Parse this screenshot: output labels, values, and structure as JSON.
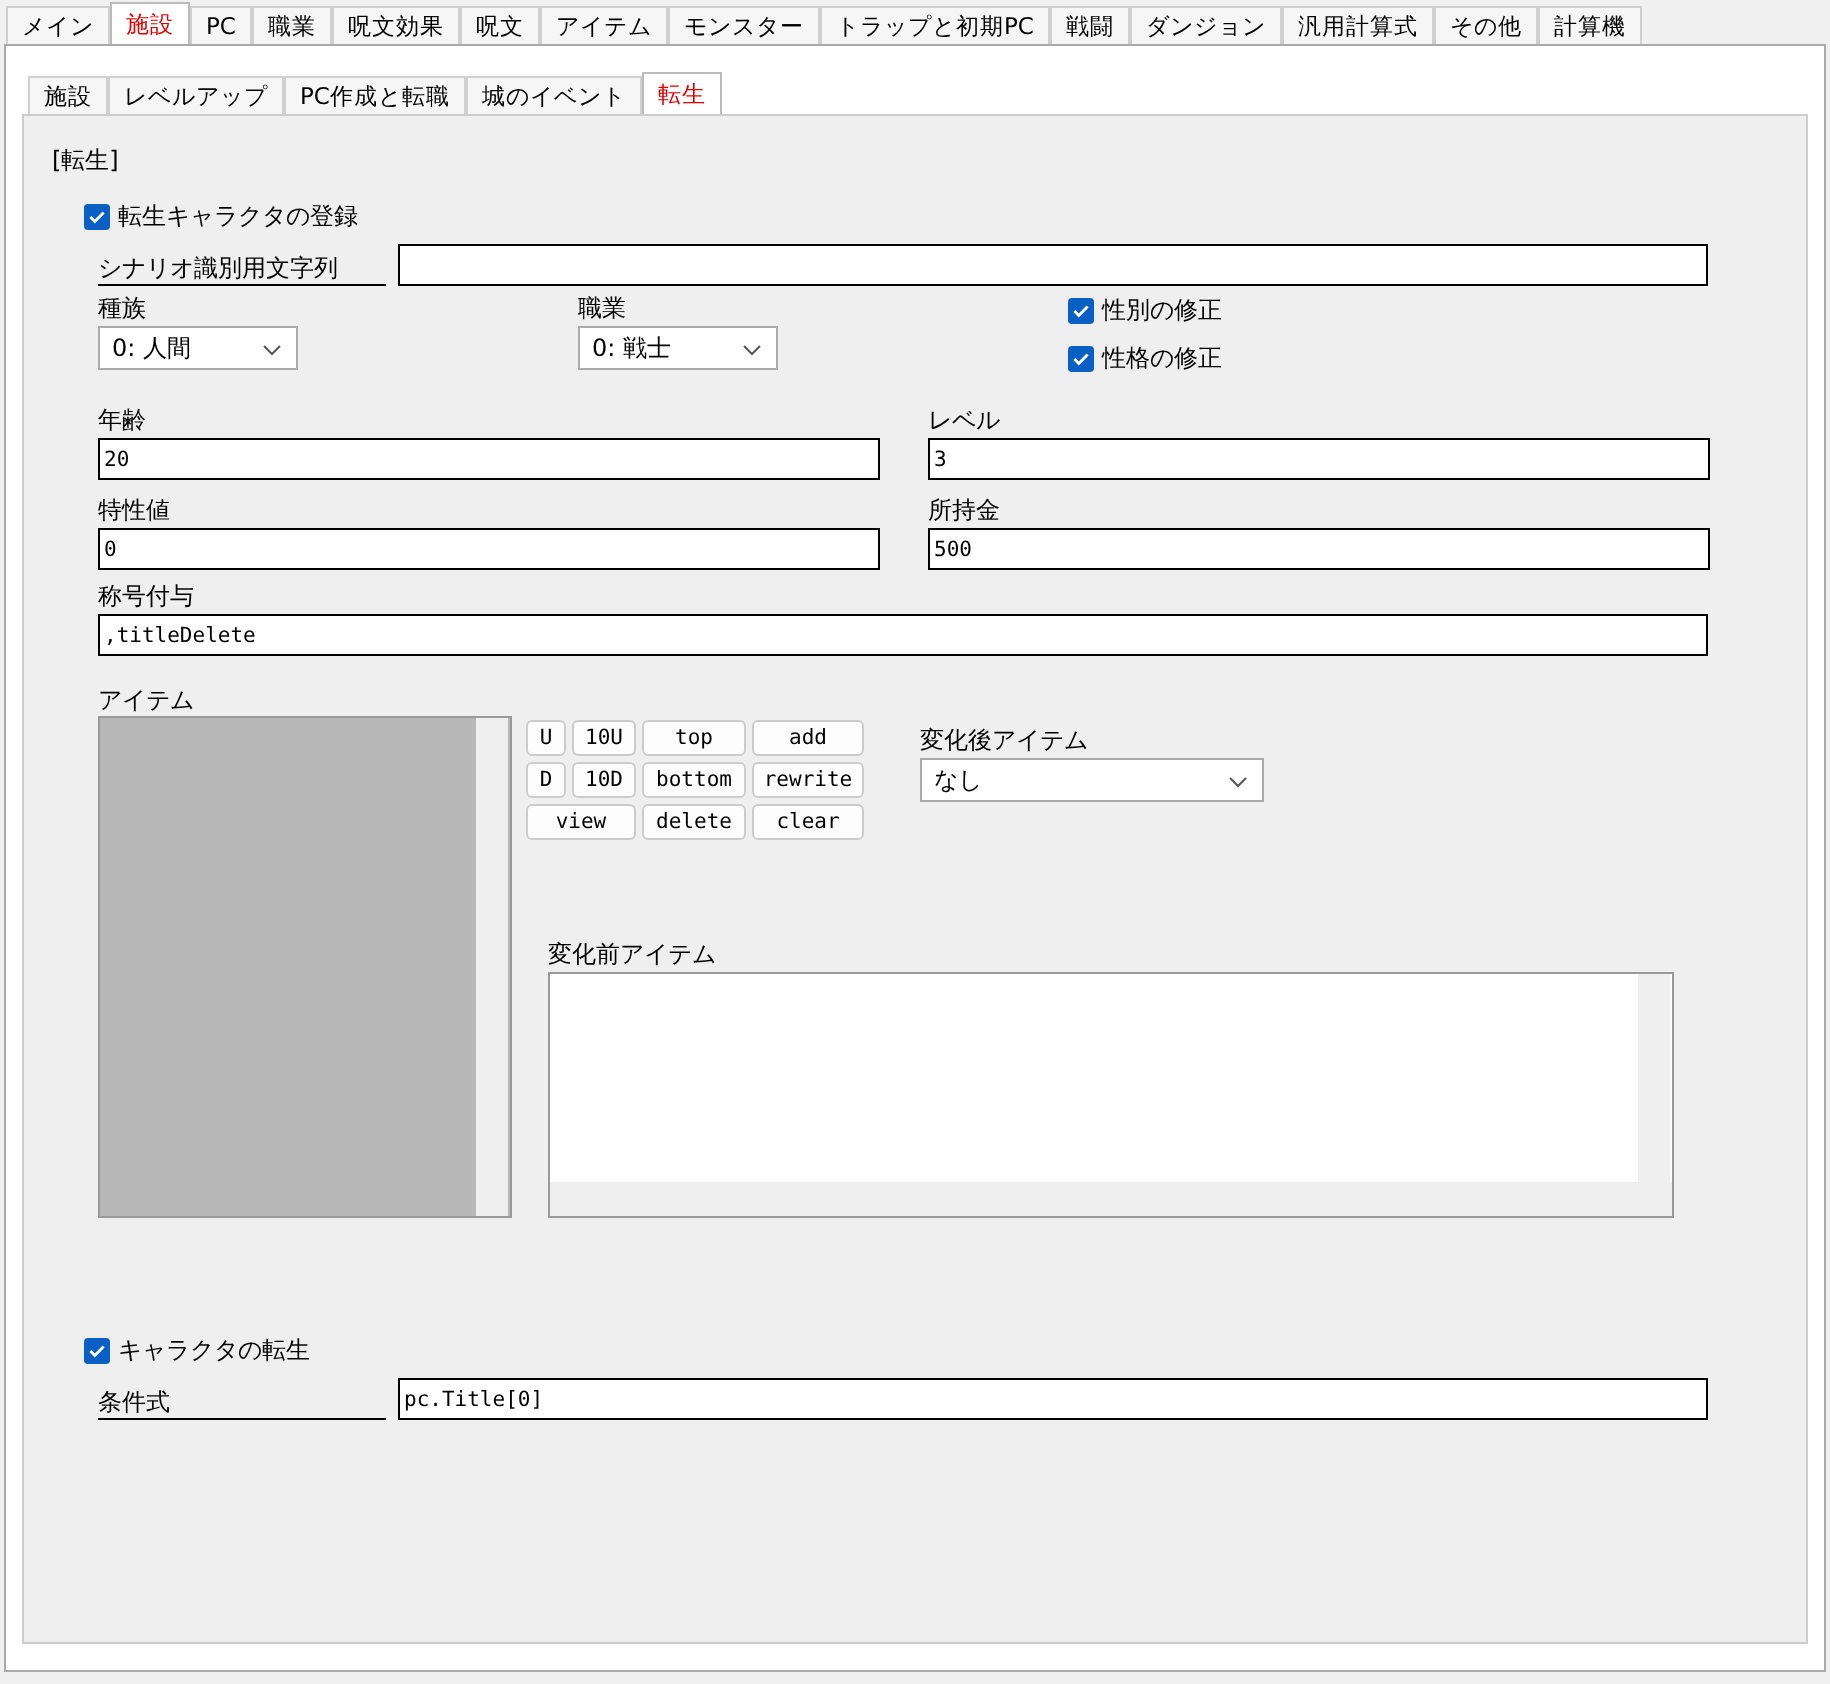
{
  "main_tabs": [
    {
      "label": "メイン",
      "selected": false
    },
    {
      "label": "施設",
      "selected": true
    },
    {
      "label": "PC",
      "selected": false
    },
    {
      "label": "職業",
      "selected": false
    },
    {
      "label": "呪文効果",
      "selected": false
    },
    {
      "label": "呪文",
      "selected": false
    },
    {
      "label": "アイテム",
      "selected": false
    },
    {
      "label": "モンスター",
      "selected": false
    },
    {
      "label": "トラップと初期PC",
      "selected": false
    },
    {
      "label": "戦闘",
      "selected": false
    },
    {
      "label": "ダンジョン",
      "selected": false
    },
    {
      "label": "汎用計算式",
      "selected": false
    },
    {
      "label": "その他",
      "selected": false
    },
    {
      "label": "計算機",
      "selected": false
    }
  ],
  "sub_tabs": [
    {
      "label": "施設",
      "selected": false
    },
    {
      "label": "レベルアップ",
      "selected": false
    },
    {
      "label": "PC作成と転職",
      "selected": false
    },
    {
      "label": "城のイベント",
      "selected": false
    },
    {
      "label": "転生",
      "selected": true
    }
  ],
  "section_title": "[転生]",
  "register": {
    "label": "転生キャラクタの登録",
    "checked": true
  },
  "scenario_id": {
    "label": "シナリオ識別用文字列"
  },
  "race": {
    "label": "種族",
    "value": "0: 人間"
  },
  "job": {
    "label": "職業",
    "value": "0: 戦士"
  },
  "fix_gender": {
    "label": "性別の修正",
    "checked": true
  },
  "fix_personality": {
    "label": "性格の修正",
    "checked": true
  },
  "age": {
    "label": "年齢",
    "value": "20"
  },
  "level": {
    "label": "レベル",
    "value": "3"
  },
  "trait": {
    "label": "特性値",
    "value": "0"
  },
  "gold": {
    "label": "所持金",
    "value": "500"
  },
  "title_grant": {
    "label": "称号付与",
    "value": ",titleDelete"
  },
  "items_label": "アイテム",
  "item_buttons": [
    "U",
    "10U",
    "top",
    "add",
    "D",
    "10D",
    "bottom",
    "rewrite",
    "view",
    "delete",
    "clear"
  ],
  "after_item": {
    "label": "変化後アイテム",
    "value": "なし"
  },
  "before_item": {
    "label": "変化前アイテム"
  },
  "rebirth": {
    "label": "キャラクタの転生",
    "checked": true
  },
  "condition": {
    "label": "条件式",
    "value": "pc.Title[0]"
  }
}
